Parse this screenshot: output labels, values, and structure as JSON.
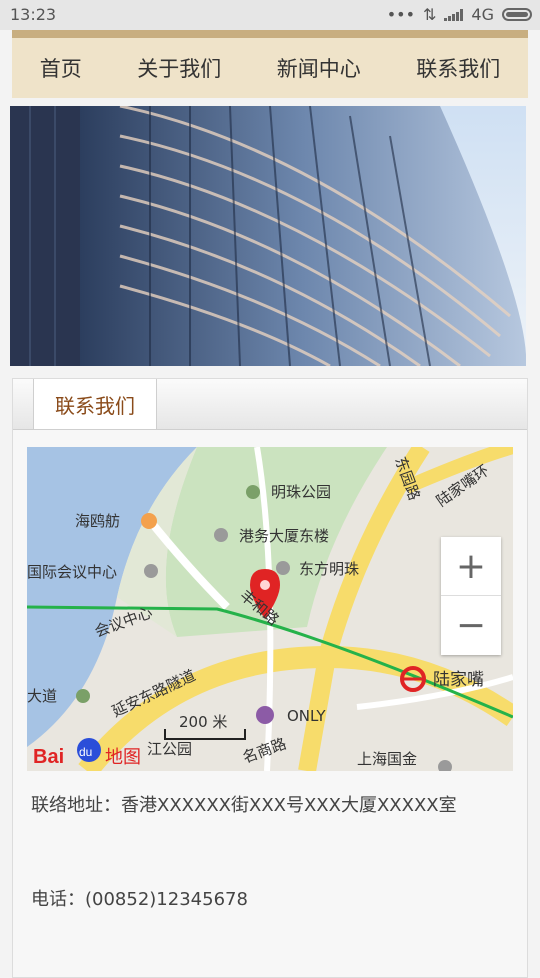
{
  "status": {
    "time": "13:23",
    "network": "4G"
  },
  "nav": {
    "items": [
      "首页",
      "关于我们",
      "新闻中心",
      "联系我们"
    ]
  },
  "tabs": {
    "active": "联系我们"
  },
  "map": {
    "labels": {
      "mingzhu_park": "明珠公园",
      "haiou": "海鸥舫",
      "gangwu": "港务大厦东楼",
      "dongfang": "东方明珠",
      "guoji": "国际会议中心",
      "fenghe": "丰和路",
      "huiyi": "会议中心",
      "dongyuan": "东园路",
      "lujiazui_ring": "陆家嘴环",
      "yanan": "延安东路隧道",
      "lujiazui_station": "陆家嘴",
      "dadao": "大道",
      "only": "ONLY",
      "park2": "江公园",
      "mingshang": "名商路",
      "shanghai_gj": "上海国金"
    },
    "scale": "200 米",
    "logo_text": "地图",
    "logo_bai": "Bai",
    "logo_du": "du"
  },
  "contact": {
    "address": "联络地址：香港XXXXXX街XXX号XXX大厦XXXXX室",
    "phone": "电话：(00852)12345678"
  }
}
